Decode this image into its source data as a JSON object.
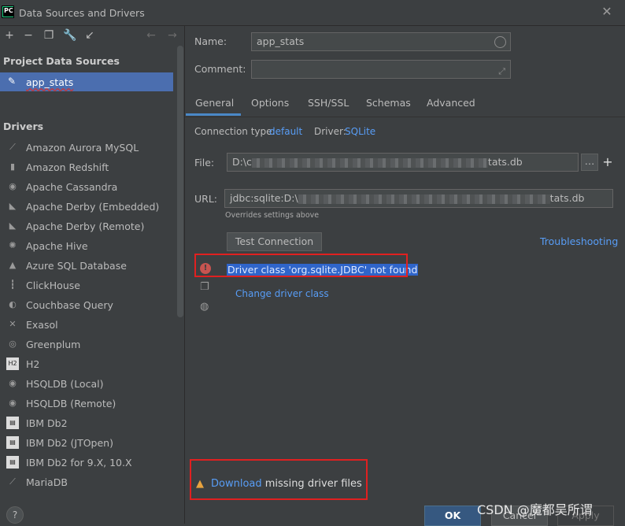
{
  "window": {
    "title": "Data Sources and Drivers",
    "logo_text": "PC"
  },
  "left": {
    "project_section": "Project Data Sources",
    "selected_source": "app_stats",
    "drivers_section": "Drivers",
    "drivers": [
      {
        "label": "Amazon Aurora MySQL",
        "icon": "aurora-icon"
      },
      {
        "label": "Amazon Redshift",
        "icon": "redshift-icon"
      },
      {
        "label": "Apache Cassandra",
        "icon": "cassandra-icon"
      },
      {
        "label": "Apache Derby (Embedded)",
        "icon": "derby-icon"
      },
      {
        "label": "Apache Derby (Remote)",
        "icon": "derby-icon"
      },
      {
        "label": "Apache Hive",
        "icon": "hive-icon"
      },
      {
        "label": "Azure SQL Database",
        "icon": "azure-icon"
      },
      {
        "label": "ClickHouse",
        "icon": "clickhouse-icon"
      },
      {
        "label": "Couchbase Query",
        "icon": "couchbase-icon"
      },
      {
        "label": "Exasol",
        "icon": "exasol-icon"
      },
      {
        "label": "Greenplum",
        "icon": "greenplum-icon"
      },
      {
        "label": "H2",
        "icon": "h2-icon"
      },
      {
        "label": "HSQLDB (Local)",
        "icon": "hsqldb-icon"
      },
      {
        "label": "HSQLDB (Remote)",
        "icon": "hsqldb-icon"
      },
      {
        "label": "IBM Db2",
        "icon": "ibm-icon"
      },
      {
        "label": "IBM Db2 (JTOpen)",
        "icon": "ibm-icon"
      },
      {
        "label": "IBM Db2 for 9.X, 10.X",
        "icon": "ibm-icon"
      },
      {
        "label": "MariaDB",
        "icon": "mariadb-icon"
      }
    ]
  },
  "form": {
    "name_label": "Name:",
    "name_value": "app_stats",
    "comment_label": "Comment:",
    "comment_value": "",
    "tabs": [
      "General",
      "Options",
      "SSH/SSL",
      "Schemas",
      "Advanced"
    ],
    "active_tab": "General",
    "connection_type_label": "Connection type:",
    "connection_type_value": "default",
    "driver_label": "Driver:",
    "driver_value": "SQLite",
    "file_label": "File:",
    "file_prefix": "D:\\c",
    "file_suffix": "tats.db",
    "url_label": "URL:",
    "url_prefix": "jdbc:sqlite:D:\\",
    "url_suffix": "tats.db",
    "url_hint": "Overrides settings above",
    "test_connection": "Test Connection",
    "troubleshooting": "Troubleshooting",
    "error_text": "Driver class 'org.sqlite.JDBC' not found",
    "change_driver_class": "Change driver class",
    "download_link": "Download",
    "download_rest": " missing driver files"
  },
  "buttons": {
    "help": "?",
    "ok": "OK",
    "cancel": "Cancel",
    "apply": "Apply"
  },
  "watermark": "CSDN @魔都吴所谓",
  "colors": {
    "selection": "#4b6eaf",
    "link": "#589df6",
    "error": "#c75450",
    "annotation": "#e02020",
    "primary_button": "#365880"
  }
}
